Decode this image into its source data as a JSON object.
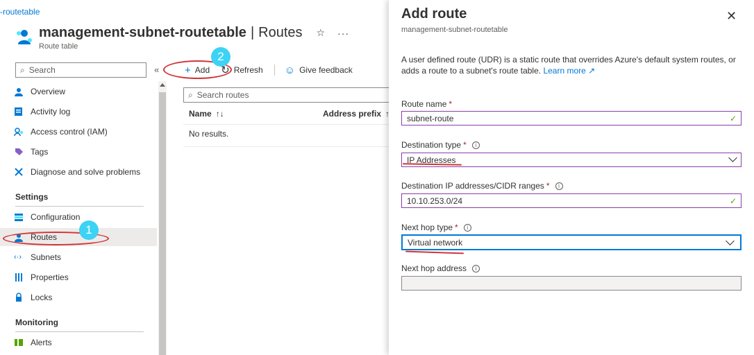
{
  "breadcrumb": {
    "text": "-routetable"
  },
  "header": {
    "title": "management-subnet-routetable",
    "separator": "|",
    "section": "Routes",
    "subtitle": "Route table",
    "favorite_icon": "star-icon",
    "more_icon": "ellipsis-icon"
  },
  "sidebar": {
    "search_placeholder": "Search",
    "collapse_glyph": "«",
    "items": [
      {
        "label": "Overview",
        "icon": "overview-icon"
      },
      {
        "label": "Activity log",
        "icon": "activity-log-icon"
      },
      {
        "label": "Access control (IAM)",
        "icon": "iam-icon"
      },
      {
        "label": "Tags",
        "icon": "tag-icon"
      },
      {
        "label": "Diagnose and solve problems",
        "icon": "wrench-icon"
      }
    ],
    "settings_heading": "Settings",
    "settings_items": [
      {
        "label": "Configuration",
        "icon": "configuration-icon"
      },
      {
        "label": "Routes",
        "icon": "routes-icon",
        "selected": true
      },
      {
        "label": "Subnets",
        "icon": "subnets-icon"
      },
      {
        "label": "Properties",
        "icon": "properties-icon"
      },
      {
        "label": "Locks",
        "icon": "lock-icon"
      }
    ],
    "monitoring_heading": "Monitoring",
    "monitoring_items": [
      {
        "label": "Alerts",
        "icon": "alerts-icon"
      }
    ]
  },
  "toolbar": {
    "add_label": "Add",
    "refresh_label": "Refresh",
    "feedback_label": "Give feedback"
  },
  "routes_table": {
    "search_placeholder": "Search routes",
    "columns": [
      "Name",
      "Address prefix"
    ],
    "sort_glyph": "↑↓",
    "empty_text": "No results."
  },
  "annotations": {
    "badge_1": "1",
    "badge_2": "2"
  },
  "panel": {
    "title": "Add route",
    "subtitle": "management-subnet-routetable",
    "description": "A user defined route (UDR) is a static route that overrides Azure's default system routes, or adds a route to a subnet's route table.",
    "learn_more": "Learn more",
    "fields": {
      "route_name": {
        "label": "Route name",
        "value": "subnet-route"
      },
      "destination_type": {
        "label": "Destination type",
        "value": "IP Addresses"
      },
      "destination_cidr": {
        "label": "Destination IP addresses/CIDR ranges",
        "value": "10.10.253.0/24"
      },
      "next_hop_type": {
        "label": "Next hop type",
        "value": "Virtual network"
      },
      "next_hop_address": {
        "label": "Next hop address",
        "value": ""
      }
    },
    "required_marker": "*",
    "info_glyph": "i"
  },
  "colors": {
    "accent": "#0078d4",
    "annotation_red": "#d13438",
    "annotation_badge": "#3cd3f5",
    "valid_green": "#57a300",
    "required_red": "#a4262c"
  }
}
